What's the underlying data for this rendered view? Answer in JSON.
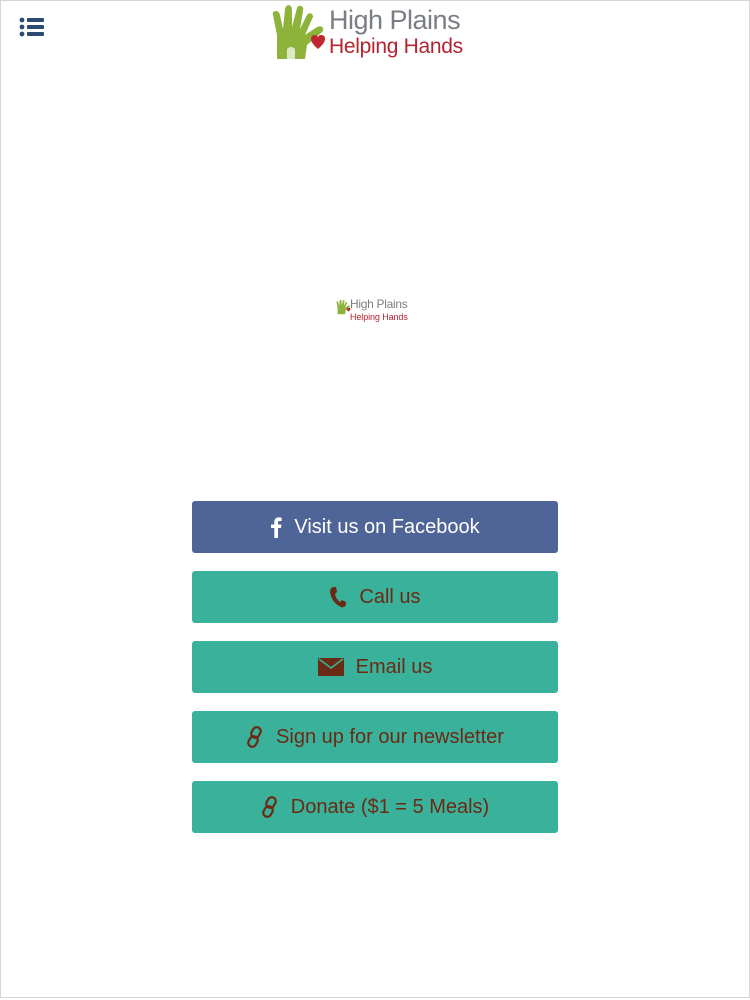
{
  "header": {
    "menu_icon": "list-menu-icon",
    "logo": {
      "line1": "High Plains",
      "line2": "Helping Hands"
    }
  },
  "main": {
    "center_logo": {
      "line1": "High Plains",
      "line2": "Helping Hands"
    },
    "buttons": [
      {
        "label": "Visit us on Facebook",
        "icon": "facebook-icon"
      },
      {
        "label": "Call us",
        "icon": "phone-icon"
      },
      {
        "label": "Email us",
        "icon": "envelope-icon"
      },
      {
        "label": "Sign up for our newsletter",
        "icon": "link-icon"
      },
      {
        "label": "Donate ($1 = 5 Meals)",
        "icon": "link-icon"
      }
    ]
  },
  "colors": {
    "facebook_button": "#4f6497",
    "action_button": "#3ab19a",
    "action_text": "#6b2a14",
    "logo_grey": "#7a7e84",
    "logo_red": "#b3242f",
    "logo_green": "#8db33b",
    "menu_icon": "#2c4a73"
  }
}
